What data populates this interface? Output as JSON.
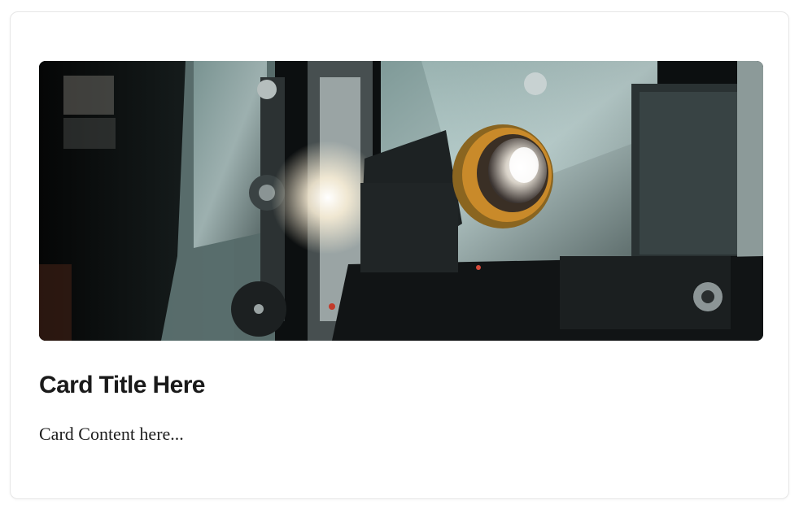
{
  "card": {
    "image_alt": "Film projector with a glowing lens",
    "title": "Card Title Here",
    "content": "Card Content here..."
  },
  "colors": {
    "card_border": "#e6e6e6",
    "title": "#1a1a1a",
    "content": "#1e1e1e",
    "lens_gold": "#c98a2a"
  }
}
